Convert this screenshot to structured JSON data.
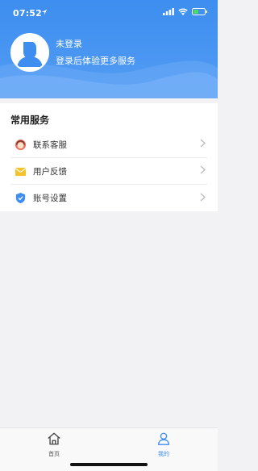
{
  "status_bar": {
    "time": "07:52"
  },
  "profile": {
    "name": "未登录",
    "subtitle": "登录后体验更多服务"
  },
  "services": {
    "title": "常用服务",
    "items": [
      {
        "label": "联系客服",
        "icon": "customer-service-icon"
      },
      {
        "label": "用户反馈",
        "icon": "feedback-icon"
      },
      {
        "label": "账号设置",
        "icon": "account-settings-icon"
      }
    ]
  },
  "tabbar": {
    "tabs": [
      {
        "label": "首页",
        "icon": "home-icon"
      },
      {
        "label": "我的",
        "icon": "profile-icon"
      }
    ]
  },
  "colors": {
    "accent": "#3d8ef0"
  }
}
